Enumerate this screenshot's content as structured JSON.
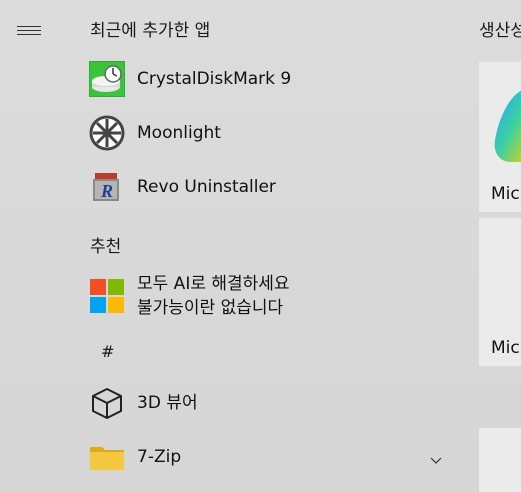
{
  "left_column": {
    "recent_header": "최근에 추가한 앱",
    "recommended_header": "추천",
    "hash_header": "#",
    "recent_apps": [
      {
        "label": "CrystalDiskMark 9",
        "icon": "crystaldiskmark-icon"
      },
      {
        "label": "Moonlight",
        "icon": "moonlight-icon"
      },
      {
        "label": "Revo Uninstaller",
        "icon": "revo-uninstaller-icon"
      }
    ],
    "recommended_app": {
      "line1": "모두 AI로 해결하세요",
      "line2": "불가능이란 없습니다",
      "icon": "microsoft-logo-icon"
    },
    "hash_apps": [
      {
        "label": "3D 뷰어",
        "icon": "cube-icon"
      },
      {
        "label": "7-Zip",
        "icon": "folder-icon",
        "expandable": true
      }
    ]
  },
  "right_column": {
    "group_header": "생산성",
    "tiles": [
      {
        "label": "Mic"
      },
      {
        "label": "Mic"
      }
    ]
  },
  "colors": {
    "background": "#d9d9d9",
    "tile": "#ebebeb"
  }
}
